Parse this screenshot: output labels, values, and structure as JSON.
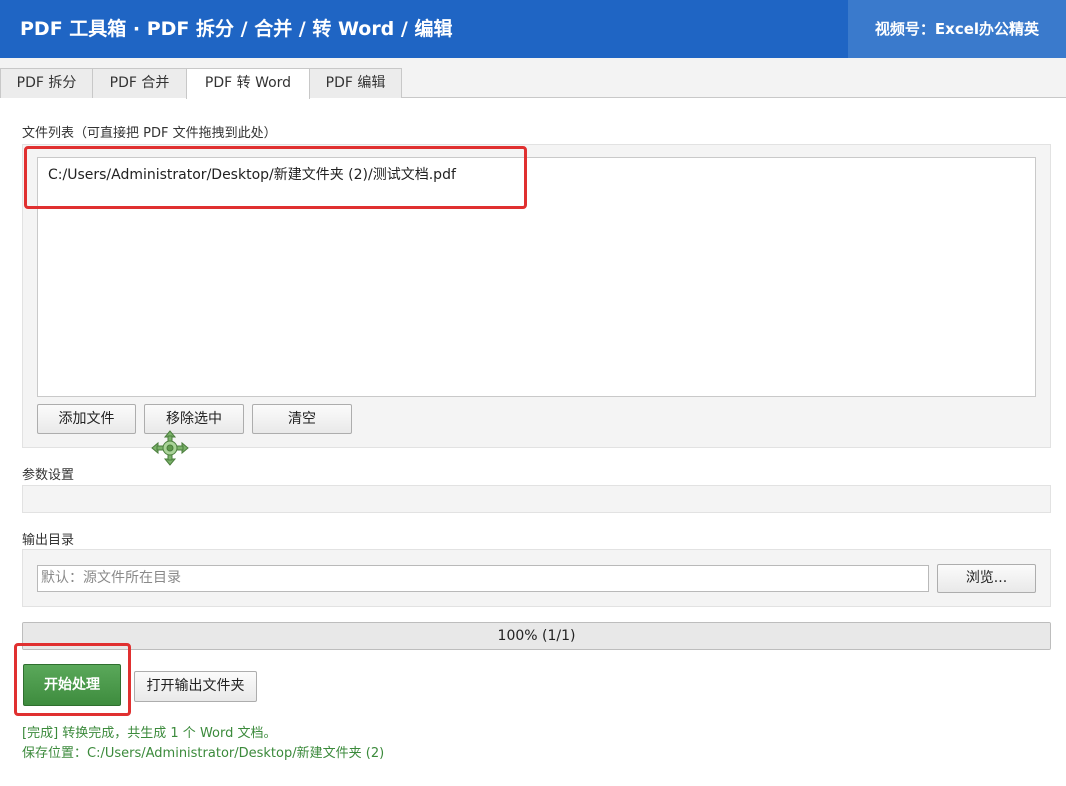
{
  "header": {
    "title": "PDF 工具箱 · PDF 拆分 / 合并 / 转 Word / 编辑",
    "badge": "视频号：Excel办公精英"
  },
  "tabs": [
    {
      "label": "PDF 拆分",
      "active": false
    },
    {
      "label": "PDF 合并",
      "active": false
    },
    {
      "label": "PDF 转 Word",
      "active": true
    },
    {
      "label": "PDF 编辑",
      "active": false
    }
  ],
  "file_section": {
    "label": "文件列表（可直接把 PDF 文件拖拽到此处）",
    "files": [
      "C:/Users/Administrator/Desktop/新建文件夹 (2)/测试文档.pdf"
    ],
    "add_button": "添加文件",
    "remove_button": "移除选中",
    "clear_button": "清空"
  },
  "params": {
    "label": "参数设置"
  },
  "output": {
    "label": "输出目录",
    "placeholder": "默认：源文件所在目录",
    "browse_button": "浏览..."
  },
  "progress": {
    "value": 1.0,
    "text": "100%  (1/1)"
  },
  "actions": {
    "start_button": "开始处理",
    "open_folder_button": "打开输出文件夹"
  },
  "status": {
    "line1": "[完成] 转换完成，共生成 1 个 Word 文档。",
    "line2": "保存位置：C:/Users/Administrator/Desktop/新建文件夹 (2)"
  },
  "colors": {
    "header_bg": "#1f65c4",
    "accent_green": "#3e8c3e",
    "highlight_red": "#e03030",
    "status_text": "#3b8a3b"
  },
  "icons": {
    "drag_cursor": "move-cursor-icon"
  }
}
